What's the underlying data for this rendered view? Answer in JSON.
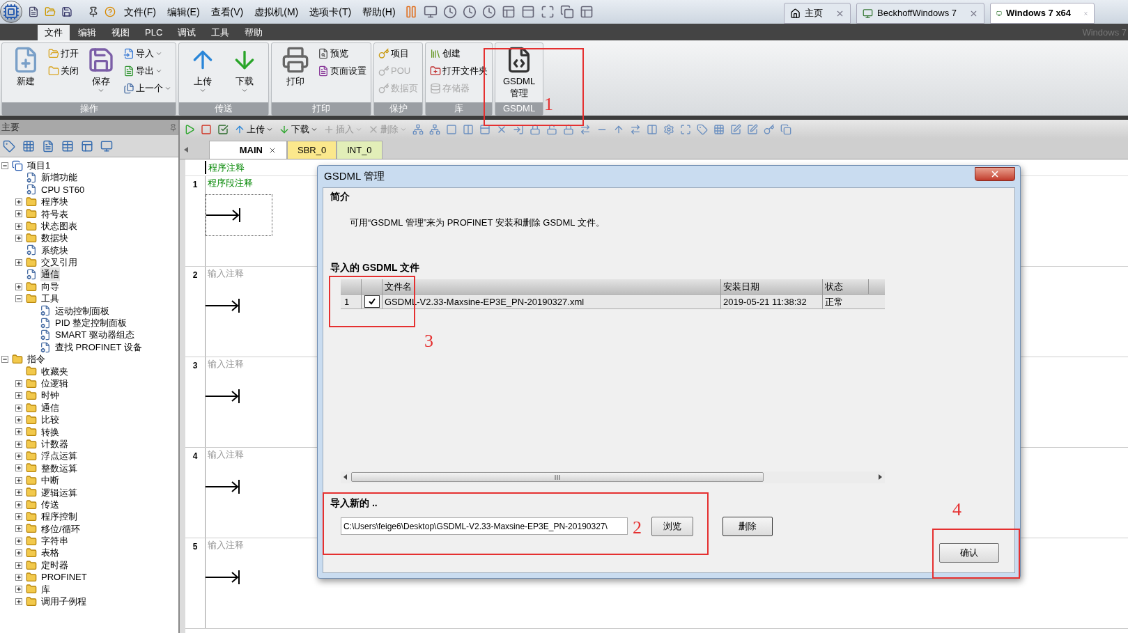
{
  "top_bar": {
    "menus": [
      "文件(F)",
      "编辑(E)",
      "查看(V)",
      "虚拟机(M)",
      "选项卡(T)",
      "帮助(H)"
    ],
    "tabs": [
      {
        "label": "主页",
        "selected": false
      },
      {
        "label": "BeckhoffWindows 7",
        "selected": false
      },
      {
        "label": "Windows 7 x64",
        "selected": true
      }
    ],
    "corner_text": "Windows 7"
  },
  "ribbon": {
    "tabs": [
      {
        "label": "文件",
        "selected": true
      },
      {
        "label": "编辑",
        "selected": false
      },
      {
        "label": "视图",
        "selected": false
      },
      {
        "label": "PLC",
        "selected": false
      },
      {
        "label": "调试",
        "selected": false
      },
      {
        "label": "工具",
        "selected": false
      },
      {
        "label": "帮助",
        "selected": false
      }
    ],
    "groups": [
      {
        "label": "操作",
        "columns": [
          [
            {
              "label": "新建",
              "kind": "large",
              "disabled": false,
              "dropdown": false
            }
          ],
          [
            {
              "label": "打开",
              "kind": "small",
              "disabled": false,
              "dropdown": false
            },
            {
              "label": "关闭",
              "kind": "small",
              "disabled": false,
              "dropdown": false
            }
          ],
          [
            {
              "label": "保存",
              "kind": "large",
              "disabled": false,
              "dropdown": true
            }
          ],
          [
            {
              "label": "导入",
              "kind": "small",
              "disabled": false,
              "dropdown": true
            },
            {
              "label": "导出",
              "kind": "small",
              "disabled": false,
              "dropdown": true
            },
            {
              "label": "上一个",
              "kind": "small",
              "disabled": false,
              "dropdown": true
            }
          ]
        ]
      },
      {
        "label": "传送",
        "columns": [
          [
            {
              "label": "上传",
              "kind": "large",
              "disabled": false,
              "dropdown": true
            }
          ],
          [
            {
              "label": "下载",
              "kind": "large",
              "disabled": false,
              "dropdown": true
            }
          ]
        ]
      },
      {
        "label": "打印",
        "columns": [
          [
            {
              "label": "打印",
              "kind": "large",
              "disabled": false,
              "dropdown": false
            }
          ],
          [
            {
              "label": "预览",
              "kind": "small",
              "disabled": false,
              "dropdown": false
            },
            {
              "label": "页面设置",
              "kind": "small",
              "disabled": false,
              "dropdown": false
            }
          ]
        ]
      },
      {
        "label": "保护",
        "columns": [
          [
            {
              "label": "项目",
              "kind": "small",
              "disabled": false,
              "dropdown": false
            },
            {
              "label": "POU",
              "kind": "small",
              "disabled": true,
              "dropdown": false
            },
            {
              "label": "数据页",
              "kind": "small",
              "disabled": true,
              "dropdown": false
            }
          ]
        ]
      },
      {
        "label": "库",
        "columns": [
          [
            {
              "label": "创建",
              "kind": "small",
              "disabled": false,
              "dropdown": false
            },
            {
              "label": "打开文件夹",
              "kind": "small",
              "disabled": false,
              "dropdown": false
            },
            {
              "label": "存储器",
              "kind": "small",
              "disabled": true,
              "dropdown": false
            }
          ]
        ]
      },
      {
        "label": "GSDML",
        "columns": [
          [
            {
              "label": "GSDML 管理",
              "kind": "large",
              "disabled": false,
              "dropdown": false
            }
          ]
        ]
      }
    ]
  },
  "sidebar": {
    "title": "主要",
    "tree": [
      {
        "label": "项目1",
        "kind": "project",
        "expanded": true,
        "selected": false,
        "children": [
          {
            "label": "新增功能",
            "kind": "item",
            "selected": false
          },
          {
            "label": "CPU ST60",
            "kind": "item",
            "selected": false
          },
          {
            "label": "程序块",
            "kind": "folder",
            "expanded": false,
            "selected": false
          },
          {
            "label": "符号表",
            "kind": "folder",
            "expanded": false,
            "selected": false
          },
          {
            "label": "状态图表",
            "kind": "folder",
            "expanded": false,
            "selected": false
          },
          {
            "label": "数据块",
            "kind": "folder",
            "expanded": false,
            "selected": false
          },
          {
            "label": "系统块",
            "kind": "item",
            "selected": false
          },
          {
            "label": "交叉引用",
            "kind": "folder",
            "expanded": false,
            "selected": false
          },
          {
            "label": "通信",
            "kind": "item",
            "selected": true
          },
          {
            "label": "向导",
            "kind": "folder",
            "expanded": false,
            "selected": false
          },
          {
            "label": "工具",
            "kind": "folder",
            "expanded": true,
            "selected": false,
            "children": [
              {
                "label": "运动控制面板",
                "kind": "item",
                "selected": false
              },
              {
                "label": "PID 整定控制面板",
                "kind": "item",
                "selected": false
              },
              {
                "label": "SMART 驱动器组态",
                "kind": "item",
                "selected": false
              },
              {
                "label": "查找 PROFINET 设备",
                "kind": "item",
                "selected": false
              }
            ]
          }
        ]
      },
      {
        "label": "指令",
        "kind": "folder",
        "expanded": true,
        "selected": false,
        "children": [
          {
            "label": "收藏夹",
            "kind": "folder",
            "selected": false
          },
          {
            "label": "位逻辑",
            "kind": "folder",
            "expanded": false,
            "selected": false
          },
          {
            "label": "时钟",
            "kind": "folder",
            "expanded": false,
            "selected": false
          },
          {
            "label": "通信",
            "kind": "folder",
            "expanded": false,
            "selected": false
          },
          {
            "label": "比较",
            "kind": "folder",
            "expanded": false,
            "selected": false
          },
          {
            "label": "转换",
            "kind": "folder",
            "expanded": false,
            "selected": false
          },
          {
            "label": "计数器",
            "kind": "folder",
            "expanded": false,
            "selected": false
          },
          {
            "label": "浮点运算",
            "kind": "folder",
            "expanded": false,
            "selected": false
          },
          {
            "label": "整数运算",
            "kind": "folder",
            "expanded": false,
            "selected": false
          },
          {
            "label": "中断",
            "kind": "folder",
            "expanded": false,
            "selected": false
          },
          {
            "label": "逻辑运算",
            "kind": "folder",
            "expanded": false,
            "selected": false
          },
          {
            "label": "传送",
            "kind": "folder",
            "expanded": false,
            "selected": false
          },
          {
            "label": "程序控制",
            "kind": "folder",
            "expanded": false,
            "selected": false
          },
          {
            "label": "移位/循环",
            "kind": "folder",
            "expanded": false,
            "selected": false
          },
          {
            "label": "字符串",
            "kind": "folder",
            "expanded": false,
            "selected": false
          },
          {
            "label": "表格",
            "kind": "folder",
            "expanded": false,
            "selected": false
          },
          {
            "label": "定时器",
            "kind": "folder",
            "expanded": false,
            "selected": false
          },
          {
            "label": "PROFINET",
            "kind": "folder",
            "expanded": false,
            "selected": false
          },
          {
            "label": "库",
            "kind": "folder",
            "expanded": false,
            "selected": false
          },
          {
            "label": "调用子例程",
            "kind": "folder",
            "expanded": false,
            "selected": false
          }
        ]
      }
    ]
  },
  "editor": {
    "toolbar": [
      {
        "label": "上传",
        "disabled": false
      },
      {
        "label": "下载",
        "disabled": false
      },
      {
        "label": "插入",
        "disabled": true
      },
      {
        "label": "删除",
        "disabled": true
      }
    ],
    "tabs": [
      {
        "label": "MAIN",
        "selected": true,
        "color": "#ffffff"
      },
      {
        "label": "SBR_0",
        "selected": false,
        "color": "#fbe88c"
      },
      {
        "label": "INT_0",
        "selected": false,
        "color": "#e2eeb8"
      }
    ],
    "program_comment": "程序注释",
    "networks": [
      {
        "number": "1",
        "comment": "程序段注释",
        "selected": true
      },
      {
        "number": "2",
        "comment": "输入注释",
        "selected": false
      },
      {
        "number": "3",
        "comment": "输入注释",
        "selected": false
      },
      {
        "number": "4",
        "comment": "输入注释",
        "selected": false
      },
      {
        "number": "5",
        "comment": "输入注释",
        "selected": false
      }
    ]
  },
  "dialog": {
    "title": "GSDML 管理",
    "intro_heading": "简介",
    "intro_text": "可用“GSDML 管理”来为 PROFINET 安装和删除 GSDML 文件。",
    "imported_heading": "导入的 GSDML 文件",
    "table": {
      "columns": [
        "文件名",
        "安装日期",
        "状态"
      ],
      "rows": [
        {
          "index": "1",
          "checked": true,
          "file": "GSDML-V2.33-Maxsine-EP3E_PN-20190327.xml",
          "date": "2019-05-21 11:38:32",
          "status": "正常"
        }
      ]
    },
    "import_heading": "导入新的 ..",
    "path_value": "C:\\Users\\feige6\\Desktop\\GSDML-V2.33-Maxsine-EP3E_PN-20190327\\",
    "browse_button": "浏览",
    "delete_button": "删除",
    "ok_button": "确认"
  },
  "annotations": [
    "1",
    "2",
    "3",
    "4"
  ]
}
